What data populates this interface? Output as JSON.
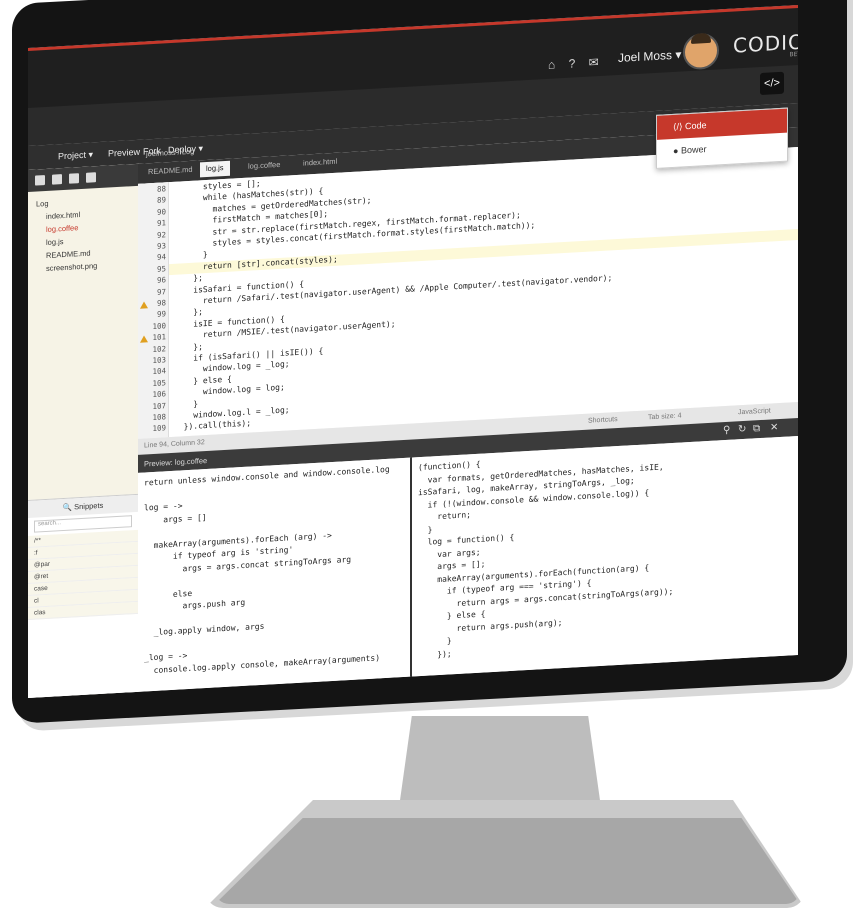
{
  "header": {
    "user_name": "Joel Moss",
    "logo": "CODIO",
    "logo_sub": "BETA",
    "code_button": "</>",
    "icons": [
      "home-icon",
      "help-icon",
      "mail-icon"
    ]
  },
  "dropdown": {
    "item1": "Code",
    "item2": "Bower"
  },
  "menu": {
    "project": "Project ▾",
    "preview": "Preview",
    "fork": "Fork",
    "deploy": "Deploy ▾"
  },
  "breadcrumb": "joelmoss / Log",
  "tabs": [
    "README.md",
    "log.js",
    "log.coffee",
    "index.html"
  ],
  "tree": {
    "root": "Log",
    "files": [
      "index.html",
      "log.coffee",
      "log.js",
      "README.md",
      "screenshot.png"
    ]
  },
  "snippets": {
    "title": "Snippets",
    "search_placeholder": "search...",
    "items": [
      "/**",
      ":f",
      "@par",
      "@ret",
      "case",
      "cl",
      "clas"
    ]
  },
  "editor": {
    "lines": [
      {
        "n": "88",
        "t": "      styles = [];"
      },
      {
        "n": "89",
        "t": "      while (hasMatches(str)) {"
      },
      {
        "n": "90",
        "t": "        matches = getOrderedMatches(str);"
      },
      {
        "n": "91",
        "t": "        firstMatch = matches[0];"
      },
      {
        "n": "92",
        "t": "        str = str.replace(firstMatch.regex, firstMatch.format.replacer);"
      },
      {
        "n": "93",
        "t": "        styles = styles.concat(firstMatch.format.styles(firstMatch.match));"
      },
      {
        "n": "94",
        "t": "      }"
      },
      {
        "n": "95",
        "t": "      return [str].concat(styles);"
      },
      {
        "n": "96",
        "t": "    };"
      },
      {
        "n": "97",
        "t": "    isSafari = function() {"
      },
      {
        "n": "98",
        "t": "      return /Safari/.test(navigator.userAgent) && /Apple Computer/.test(navigator.vendor);"
      },
      {
        "n": "99",
        "t": "    };"
      },
      {
        "n": "100",
        "t": "    isIE = function() {"
      },
      {
        "n": "101",
        "t": "      return /MSIE/.test(navigator.userAgent);"
      },
      {
        "n": "102",
        "t": "    };"
      },
      {
        "n": "103",
        "t": "    if (isSafari() || isIE()) {"
      },
      {
        "n": "104",
        "t": "      window.log = _log;"
      },
      {
        "n": "105",
        "t": "    } else {"
      },
      {
        "n": "106",
        "t": "      window.log = log;"
      },
      {
        "n": "107",
        "t": "    }"
      },
      {
        "n": "108",
        "t": "    window.log.l = _log;"
      },
      {
        "n": "109",
        "t": "  }).call(this);"
      }
    ]
  },
  "status": {
    "position": "Line 94, Column 32",
    "shortcuts": "Shortcuts",
    "tabsize": "Tab size: 4",
    "language": "JavaScript"
  },
  "preview": {
    "title": "Preview: log.coffee",
    "left": [
      "return unless window.console and window.console.log",
      "",
      "log = ->",
      "    args = []",
      "",
      "  makeArray(arguments).forEach (arg) ->",
      "      if typeof arg is 'string'",
      "        args = args.concat stringToArgs arg",
      "",
      "      else",
      "        args.push arg",
      "",
      "  _log.apply window, args",
      "",
      "_log = ->",
      "  console.log.apply console, makeArray(arguments)"
    ],
    "right": [
      "(function() {",
      "  var formats, getOrderedMatches, hasMatches, isIE,",
      "isSafari, log, makeArray, stringToArgs, _log;",
      "  if (!(window.console && window.console.log)) {",
      "    return;",
      "  }",
      "  log = function() {",
      "    var args;",
      "    args = [];",
      "    makeArray(arguments).forEach(function(arg) {",
      "      if (typeof arg === 'string') {",
      "        return args = args.concat(stringToArgs(arg));",
      "      } else {",
      "        return args.push(arg);",
      "      }",
      "    });"
    ]
  }
}
